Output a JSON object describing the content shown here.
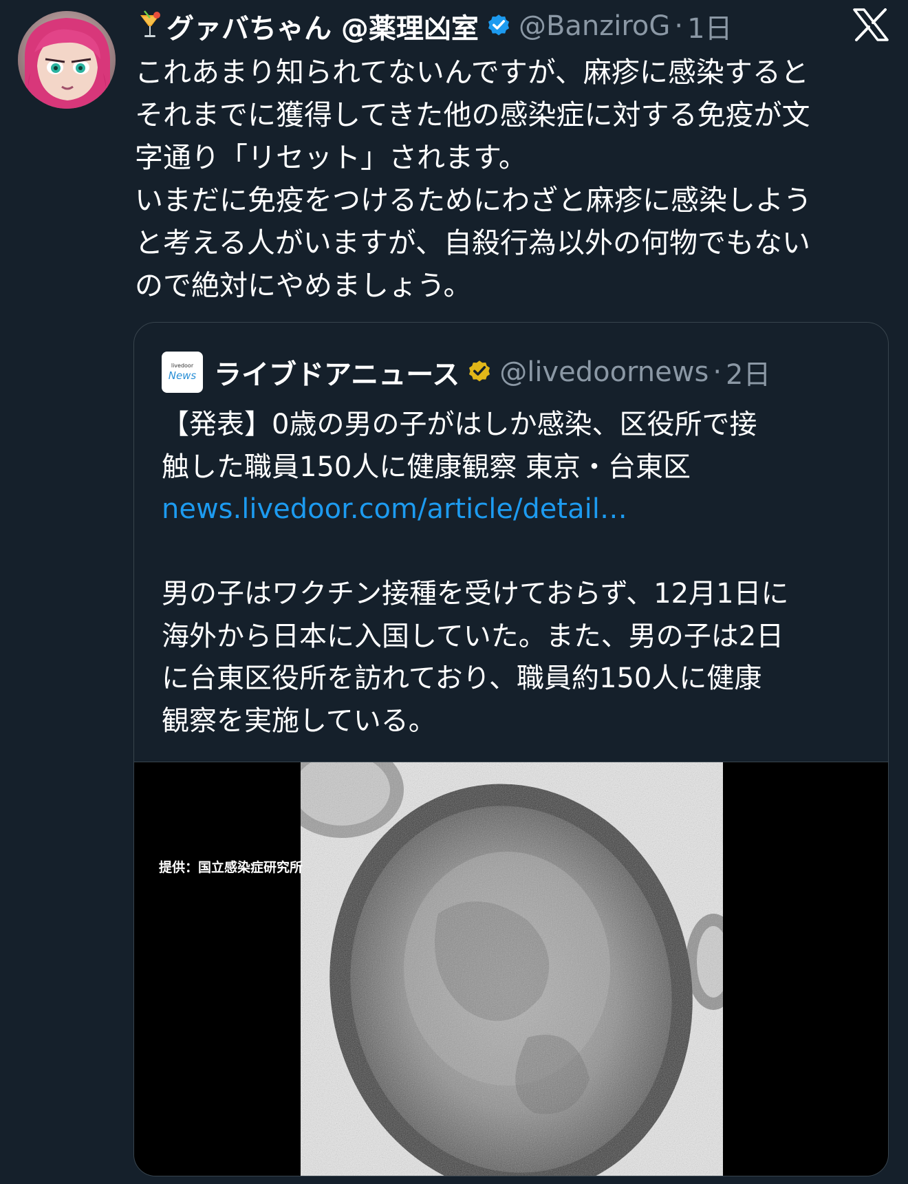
{
  "tweet": {
    "display_name": "グァバちゃん @薬理凶室",
    "handle": "@BanziroG",
    "separator": "·",
    "time": "1日",
    "lines": [
      "これあまり知られてないんですが、麻疹に感染すると",
      "それまでに獲得してきた他の感染症に対する免疫が文",
      "字通り「リセット」されます。",
      "いまだに免疫をつけるためにわざと麻疹に感染しよう",
      "と考える人がいますが、自殺行為以外の何物でもない",
      "ので絶対にやめましょう。"
    ],
    "icons": {
      "emoji": "cocktail-icon",
      "verified": "verified-badge-icon",
      "platform": "x-logo-icon"
    },
    "colors": {
      "background": "#15202b",
      "secondary_text": "#8b98a5",
      "verified_blue": "#1d9bf0",
      "verified_gold": "#e2b719"
    }
  },
  "quote": {
    "logo": {
      "small": "livedoor",
      "big": "News"
    },
    "display_name": "ライブドアニュース",
    "handle": "@livedoornews",
    "separator": "·",
    "time": "2日",
    "headline_lines": [
      "【発表】0歳の男の子がはしか感染、区役所で接",
      "触した職員150人に健康観察 東京・台東区"
    ],
    "link": "news.livedoor.com/article/detail…",
    "body_lines": [
      "男の子はワクチン接種を受けておらず、12月1日に",
      "海外から日本に入国していた。また、男の子は2日",
      "に台東区役所を訪れており、職員約150人に健康",
      "観察を実施している。"
    ],
    "image_credit": "提供：国立感染症研究所"
  }
}
